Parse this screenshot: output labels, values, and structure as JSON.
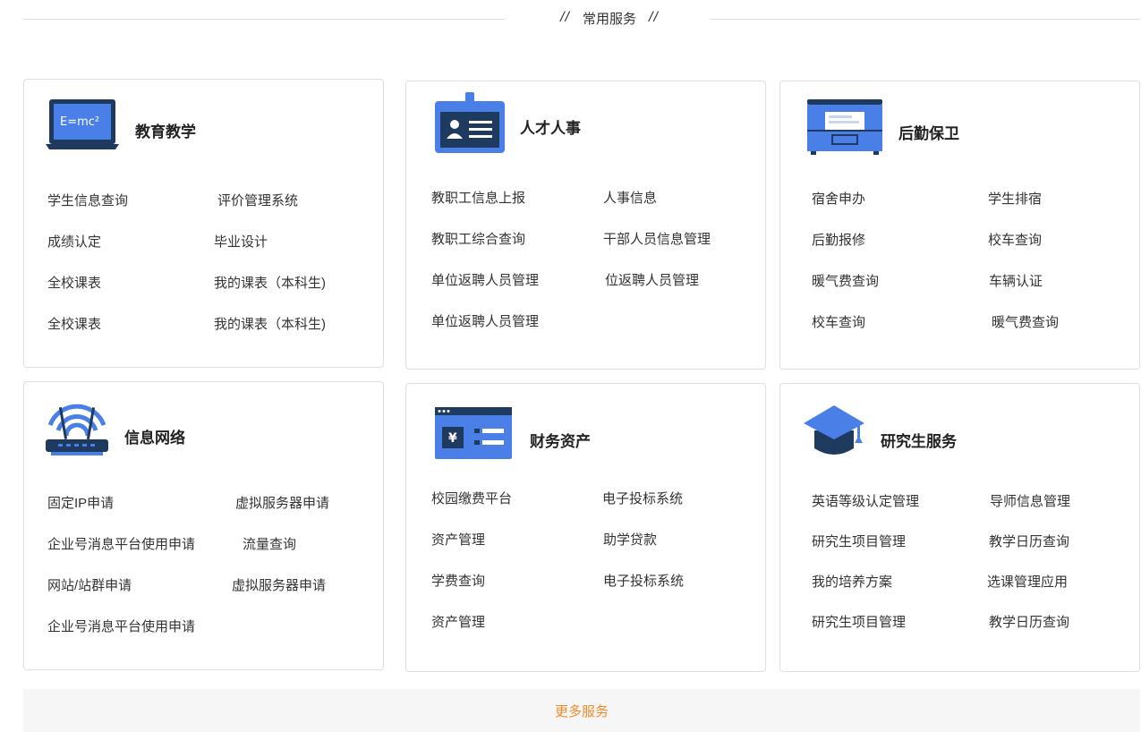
{
  "header": {
    "left_slash": "//",
    "title": "常用服务",
    "right_slash": "//"
  },
  "colors": {
    "accent_blue": "#4a7fe8",
    "dark_navy": "#1f3a5f",
    "more_orange": "#f08a2c"
  },
  "cards": [
    {
      "title": "教育教学",
      "icon": "laptop-emc2-icon",
      "icon_text": "E=mc²",
      "links": [
        "学生信息查询",
        "评价管理系统",
        "成绩认定",
        "毕业设计",
        "全校课表",
        "我的课表（本科生)",
        "全校课表",
        "我的课表（本科生)"
      ]
    },
    {
      "title": "人才人事",
      "icon": "id-badge-icon",
      "links": [
        "教职工信息上报",
        "人事信息",
        "教职工综合查询",
        "干部人员信息管理",
        "单位返聘人员管理",
        "位返聘人员管理",
        "单位返聘人员管理"
      ]
    },
    {
      "title": "后勤保卫",
      "icon": "file-drawer-icon",
      "links": [
        "宿舍申办",
        "学生排宿",
        "后勤报修",
        "校车查询",
        "暖气费查询",
        "车辆认证",
        "校车查询",
        "暖气费查询"
      ]
    },
    {
      "title": "信息网络",
      "icon": "wifi-router-icon",
      "links": [
        "固定IP申请",
        "虚拟服务器申请",
        "企业号消息平台使用申请",
        "流量查询",
        "网站/站群申请",
        "虚拟服务器申请",
        "企业号消息平台使用申请"
      ]
    },
    {
      "title": "财务资产",
      "icon": "finance-window-icon",
      "icon_text": "¥",
      "links": [
        "校园缴费平台",
        "电子投标系统",
        "资产管理",
        "助学贷款",
        "学费查询",
        "电子投标系统",
        "资产管理"
      ]
    },
    {
      "title": "研究生服务",
      "icon": "graduation-cap-icon",
      "links": [
        "英语等级认定管理",
        "导师信息管理",
        "研究生项目管理",
        "教学日历查询",
        "我的培养方案",
        "选课管理应用",
        "研究生项目管理",
        "教学日历查询"
      ]
    }
  ],
  "more_button": "更多服务"
}
